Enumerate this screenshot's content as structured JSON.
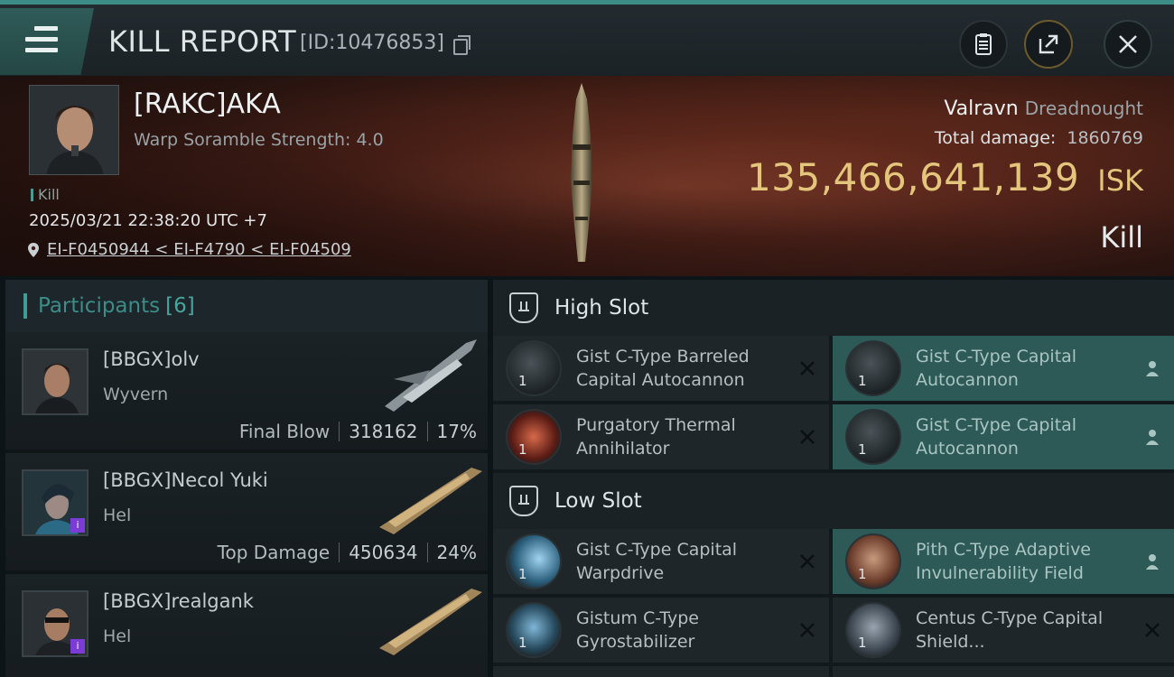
{
  "header": {
    "title": "KILL REPORT",
    "report_id": "[ID:10476853]",
    "icons": [
      "menu-icon",
      "copy-icon",
      "clipboard-icon",
      "share-icon",
      "close-icon"
    ]
  },
  "victim": {
    "name": "[RAKC]AKA",
    "subtitle": "Warp Soramble Strength: 4.0",
    "tag": "Kill",
    "datetime": "2025/03/21 22:38:20 UTC +7",
    "location": "EI-F0450944 < EI-F4790 < EI-F04509",
    "ship_name": "Valravn",
    "ship_class": "Dreadnought",
    "damage_label": "Total damage:",
    "damage_value": "1860769",
    "isk_value": "135,466,641,139",
    "isk_unit": "ISK",
    "result": "Kill"
  },
  "participants": {
    "label": "Participants",
    "count": "[6]",
    "rows": [
      {
        "name": "[BBGX]olv",
        "ship": "Wyvern",
        "stat_label": "Final Blow",
        "damage": "318162",
        "percent": "17%"
      },
      {
        "name": "[BBGX]Necol Yuki",
        "ship": "Hel",
        "stat_label": "Top Damage",
        "damage": "450634",
        "percent": "24%"
      },
      {
        "name": "[BBGX]realgank",
        "ship": "Hel",
        "stat_label": "",
        "damage": "",
        "percent": ""
      }
    ]
  },
  "fitting": {
    "high_slot": {
      "title": "High Slot",
      "modules": [
        {
          "name": "Gist C-Type Barreled Capital Autocannon",
          "qty": "1",
          "status": "destroyed"
        },
        {
          "name": "Gist C-Type Capital Autocannon",
          "qty": "1",
          "status": "dropped"
        },
        {
          "name": "Purgatory Thermal Annihilator",
          "qty": "1",
          "status": "destroyed"
        },
        {
          "name": "Gist C-Type Capital Autocannon",
          "qty": "1",
          "status": "dropped"
        }
      ]
    },
    "low_slot": {
      "title": "Low Slot",
      "modules": [
        {
          "name": "Gist C-Type Capital Warpdrive",
          "qty": "1",
          "status": "destroyed"
        },
        {
          "name": "Pith C-Type Adaptive Invulnerability Field",
          "qty": "1",
          "status": "dropped"
        },
        {
          "name": "Gistum C-Type Gyrostabilizer",
          "qty": "1",
          "status": "destroyed"
        },
        {
          "name": "Centus C-Type Capital Shield...",
          "qty": "1",
          "status": "destroyed"
        }
      ]
    }
  },
  "colors": {
    "accent": "#3c8c88",
    "isk": "#e3c67b",
    "fitted_bg": "#2d5a57"
  }
}
